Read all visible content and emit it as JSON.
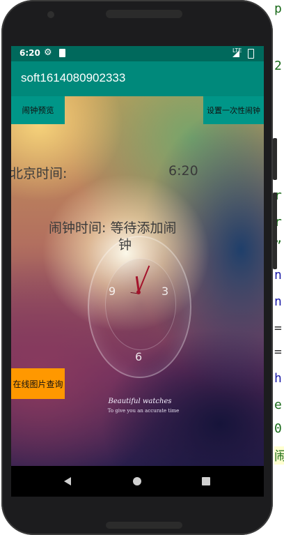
{
  "status_bar": {
    "time": "6:20",
    "network": "LTE"
  },
  "app_bar": {
    "title": "soft1614080902333"
  },
  "buttons": {
    "alarm_preview": "闹钟预览",
    "set_one_time_alarm": "设置一次性闹钟",
    "online_image_search": "在线图片查询"
  },
  "beijing_time": {
    "label": "北京时间:",
    "value": "6:20"
  },
  "alarm_time": {
    "line1": "闹钟时间: 等待添加闹",
    "line2": "钟"
  },
  "watch_face": {
    "numeral_9": "9",
    "numeral_3": "3",
    "numeral_6": "6",
    "brand": "Beautiful watches",
    "tagline": "To give you an accurate time"
  },
  "colors": {
    "status_bar": "#00695c",
    "app_bar": "#00897b",
    "teal_button": "#009688",
    "orange_button": "#ff9800"
  },
  "icons": [
    "gear-icon",
    "sd-card-icon",
    "signal-icon",
    "battery-icon",
    "back-icon",
    "home-icon",
    "recents-icon"
  ],
  "editor_fragments": [
    "p",
    "2",
    "r",
    "r",
    "”",
    "n",
    "n",
    "=",
    "=",
    "h",
    "e",
    "0",
    "闹"
  ]
}
